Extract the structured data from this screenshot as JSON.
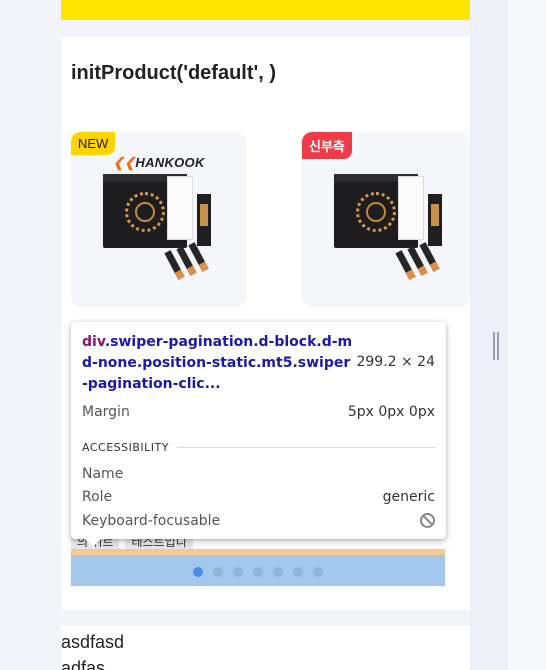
{
  "page": {
    "title": "initProduct('default', )"
  },
  "products": [
    {
      "badge": "NEW",
      "brand": "HANKOOK"
    },
    {
      "badge": "신부측"
    }
  ],
  "chips": [
    "의 쉬르",
    "테스트입니"
  ],
  "pagination": {
    "dot_count": 7,
    "active_index": 0
  },
  "text_lines": [
    "asdfasd",
    "adfas"
  ],
  "tooltip": {
    "tag": "div",
    "selector": ".swiper-pagination.d-block.d-md-none.position-static.mt5.swiper-pagination-clic...",
    "dimensions": "299.2 × 24",
    "margin_label": "Margin",
    "margin_value": "5px 0px 0px",
    "section_title": "ACCESSIBILITY",
    "name_label": "Name",
    "role_label": "Role",
    "role_value": "generic",
    "focusable_label": "Keyboard-focusable"
  },
  "colors": {
    "highlight_blue": "#a3c6eb",
    "highlight_orange": "#f6c992",
    "header_yellow": "#ffe600",
    "tag_purple": "#881280",
    "selector_blue": "#1a1aa6"
  }
}
